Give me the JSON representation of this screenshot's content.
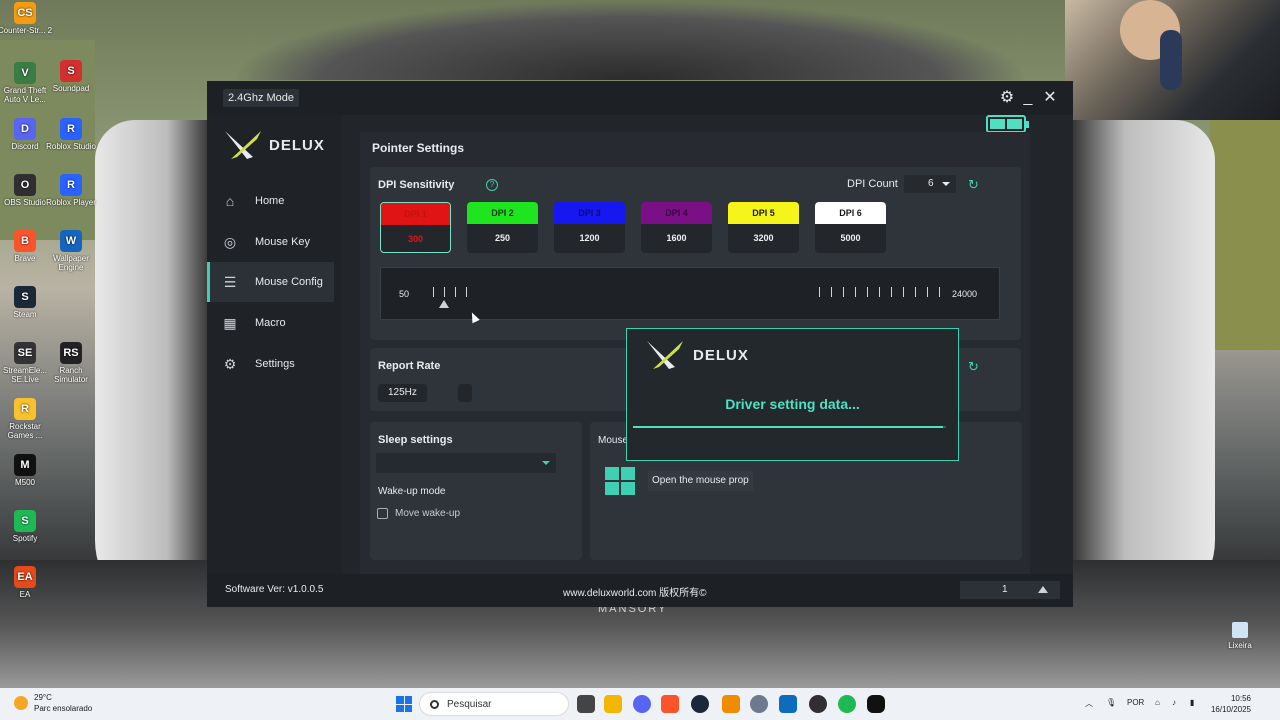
{
  "desktop": {
    "icons": [
      {
        "label": "Counter-Str... 2",
        "color": "#f39c12",
        "glyph": "CS"
      },
      {
        "label": "Grand Theft Auto V Le...",
        "color": "#3a7d44",
        "glyph": "V"
      },
      {
        "label": "Soundpad",
        "color": "#d32f2f",
        "glyph": "S"
      },
      {
        "label": "Discord",
        "color": "#5865f2",
        "glyph": "D"
      },
      {
        "label": "Roblox Studio",
        "color": "#2962ff",
        "glyph": "R"
      },
      {
        "label": "OBS Studio",
        "color": "#302e31",
        "glyph": "O"
      },
      {
        "label": "Roblox Player",
        "color": "#2962ff",
        "glyph": "R"
      },
      {
        "label": "Brave",
        "color": "#fb542b",
        "glyph": "B"
      },
      {
        "label": "Wallpaper Engine",
        "color": "#1565c0",
        "glyph": "W"
      },
      {
        "label": "Steam",
        "color": "#1b2838",
        "glyph": "S"
      },
      {
        "label": "StreamEle... SE.Live",
        "color": "#333333",
        "glyph": "SE"
      },
      {
        "label": "Ranch Simulator",
        "color": "#222222",
        "glyph": "RS"
      },
      {
        "label": "Rockstar Games ...",
        "color": "#fbc02d",
        "glyph": "R"
      },
      {
        "label": "M500",
        "color": "#111111",
        "glyph": "M"
      },
      {
        "label": "Spotify",
        "color": "#1db954",
        "glyph": "S"
      },
      {
        "label": "EA",
        "color": "#e64a19",
        "glyph": "EA"
      }
    ],
    "recycle_label": "Lixeira",
    "wallpaper_text": "MANSORY"
  },
  "app": {
    "mode_badge": "2.4Ghz Mode",
    "logo_text": "DELUX",
    "window_icons": {
      "settings": "gear-icon",
      "minimize": "minimize-icon",
      "close": "close-icon"
    },
    "battery_level": 1.0,
    "nav": [
      {
        "label": "Home",
        "icon": "home-icon",
        "glyph": "⌂"
      },
      {
        "label": "Mouse Key",
        "icon": "mouse-icon",
        "glyph": "◎"
      },
      {
        "label": "Mouse Config",
        "icon": "sliders-icon",
        "glyph": "☰"
      },
      {
        "label": "Macro",
        "icon": "keyboard-icon",
        "glyph": "▦"
      },
      {
        "label": "Settings",
        "icon": "settings-icon",
        "glyph": "⚙"
      }
    ],
    "active_nav": "Mouse Config",
    "page_title": "Pointer Settings",
    "dpi": {
      "title": "DPI Sensitivity",
      "count_label": "DPI Count",
      "count_value": "6",
      "stages": [
        {
          "label": "DPI 1",
          "value": "300",
          "color": "#e01414",
          "text_color": "#c0140e",
          "selected": true
        },
        {
          "label": "DPI 2",
          "value": "250",
          "color": "#1fe51f",
          "text_color": "#0a3d0a",
          "selected": false
        },
        {
          "label": "DPI 3",
          "value": "1200",
          "color": "#1717f0",
          "text_color": "#0a0a80",
          "selected": false
        },
        {
          "label": "DPI 4",
          "value": "1600",
          "color": "#7a0f86",
          "text_color": "#3d0644",
          "selected": false
        },
        {
          "label": "DPI 5",
          "value": "3200",
          "color": "#f5f51a",
          "text_color": "#1a1a1a",
          "selected": false
        },
        {
          "label": "DPI 6",
          "value": "5000",
          "color": "#ffffff",
          "text_color": "#1a1a1a",
          "selected": false
        }
      ],
      "slider_min": "50",
      "slider_max": "24000"
    },
    "report_rate": {
      "title": "Report Rate",
      "options": [
        "125Hz"
      ]
    },
    "sleep": {
      "title": "Sleep settings",
      "wake_title": "Wake-up mode",
      "move_wake_label": "Move wake-up"
    },
    "mouse_props": {
      "title": "Mouse properties",
      "button_label": "Open the mouse prop"
    },
    "footer": {
      "version": "Software Ver: v1.0.0.5",
      "site": "www.deluxworld.com 版权所有©",
      "profile": "1"
    },
    "modal": {
      "logo_text": "DELUX",
      "message": "Driver setting data...",
      "progress": 0.99
    }
  },
  "taskbar": {
    "weather_temp": "29°C",
    "weather_desc": "Parc ensolarado",
    "search_placeholder": "Pesquisar",
    "language": "POR",
    "time": "10:56",
    "date": "16/10/2025"
  }
}
